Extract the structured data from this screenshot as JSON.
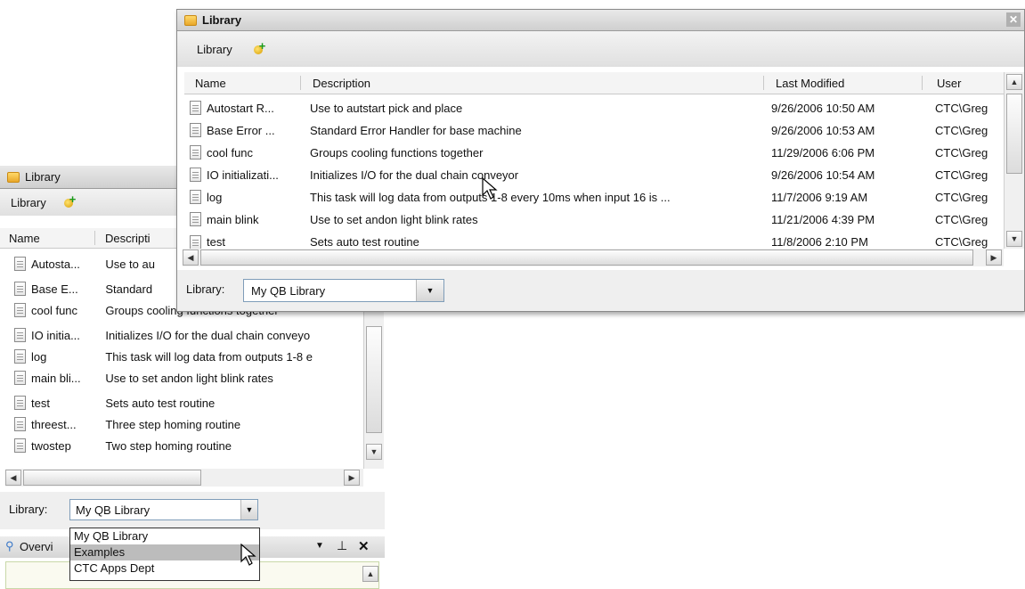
{
  "back_window": {
    "title": "Library",
    "toolbar_label": "Library",
    "columns": [
      "Name",
      "Descripti"
    ],
    "rows": [
      {
        "name": "Autosta...",
        "desc": "Use to au"
      },
      {
        "name": "Base E...",
        "desc": "Standard"
      },
      {
        "name": "cool func",
        "desc": "Groups cooling functions together"
      },
      {
        "name": "IO initia...",
        "desc": "Initializes I/O for the dual chain conveyo"
      },
      {
        "name": "log",
        "desc": "This task will log data from outputs 1-8 e"
      },
      {
        "name": "main bli...",
        "desc": "Use to set andon light blink rates"
      },
      {
        "name": "test",
        "desc": "Sets auto test routine"
      },
      {
        "name": "threest...",
        "desc": "Three step homing routine"
      },
      {
        "name": "twostep",
        "desc": "Two step homing routine"
      }
    ],
    "library_label": "Library:",
    "library_value": "My QB Library",
    "dropdown_options": [
      "My QB Library",
      "Examples",
      "CTC Apps Dept"
    ],
    "dropdown_highlight": "Examples",
    "overview_label": "Overvi"
  },
  "front_window": {
    "title": "Library",
    "toolbar_label": "Library",
    "columns": [
      "Name",
      "Description",
      "Last Modified",
      "User"
    ],
    "rows": [
      {
        "name": "Autostart R...",
        "desc": "Use to autstart pick and place",
        "modified": "9/26/2006 10:50 AM",
        "user": "CTC\\Greg"
      },
      {
        "name": "Base Error ...",
        "desc": "Standard Error Handler for base machine",
        "modified": "9/26/2006 10:53 AM",
        "user": "CTC\\Greg"
      },
      {
        "name": "cool func",
        "desc": "Groups cooling functions together",
        "modified": "11/29/2006 6:06 PM",
        "user": "CTC\\Greg"
      },
      {
        "name": "IO initializati...",
        "desc": "Initializes I/O for the dual chain conveyor",
        "modified": "9/26/2006 10:54 AM",
        "user": "CTC\\Greg"
      },
      {
        "name": "log",
        "desc": "This task will log data from outputs 1-8 every 10ms when input 16 is ...",
        "modified": "11/7/2006 9:19 AM",
        "user": "CTC\\Greg"
      },
      {
        "name": "main blink",
        "desc": "Use to set andon light blink rates",
        "modified": "11/21/2006 4:39 PM",
        "user": "CTC\\Greg"
      },
      {
        "name": "test",
        "desc": "Sets auto test routine",
        "modified": "11/8/2006 2:10 PM",
        "user": "CTC\\Greg"
      }
    ],
    "library_label": "Library:",
    "library_value": "My QB Library"
  },
  "icons": [
    "folder-icon",
    "add-item-icon",
    "document-icon",
    "close-icon",
    "pin-icon",
    "dropdown-arrow-icon",
    "mouse-cursor-icon"
  ],
  "colors": {
    "selection": "#bcbcbc",
    "title_bg": "#d9d9d9",
    "combo_border": "#7f9db9"
  }
}
